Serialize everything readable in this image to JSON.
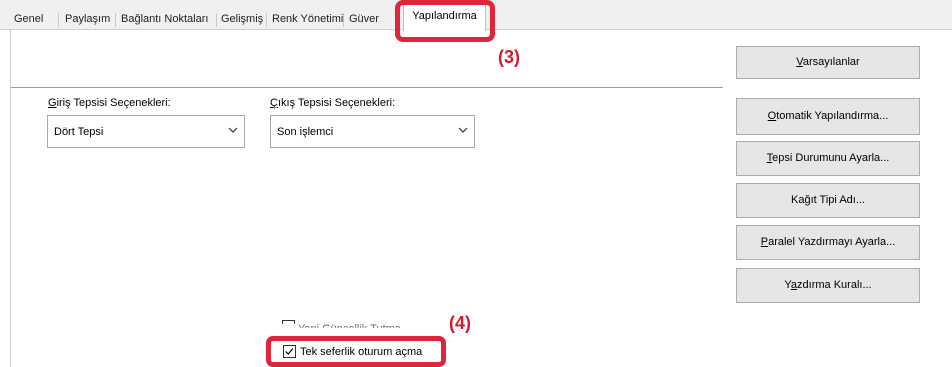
{
  "tabs": [
    "Genel",
    "Paylaşım",
    "Bağlantı Noktaları",
    "Gelişmiş",
    "Renk Yönetimi",
    "Güver"
  ],
  "active_tab": "Yapılandırma",
  "annotations": {
    "tab": "(3)",
    "checkbox": "(4)"
  },
  "buttons": {
    "defaults": {
      "underline": "V",
      "rest": "arsayılanlar"
    },
    "auto_config": {
      "underline": "O",
      "rest": "tomatik Yapılandırma..."
    },
    "tray_status": {
      "underline": "T",
      "rest": "epsi Durumunu Ayarla..."
    },
    "paper_type": {
      "before": "Ka",
      "underline": "ğ",
      "rest": "ıt Tipi Adı..."
    },
    "parallel_print": {
      "underline": "P",
      "rest": "aralel Yazdırmayı Ayarla..."
    },
    "print_rule": {
      "before": "Y",
      "underline": "a",
      "rest": "zdırma Kuralı..."
    }
  },
  "input_tray": {
    "label_underline": "G",
    "label_rest": "iriş Tepsisi Seçenekleri:",
    "value": "Dört Tepsi"
  },
  "output_tray": {
    "label_underline": "Ç",
    "label_rest": "ıkış Tepsisi Seçenekleri:",
    "value": "Son işlemci"
  },
  "checkboxes": {
    "partial_label": "Yeni Güncellik Tutma",
    "single_signon": {
      "label": "Tek seferlik oturum açma",
      "checked": true
    }
  }
}
